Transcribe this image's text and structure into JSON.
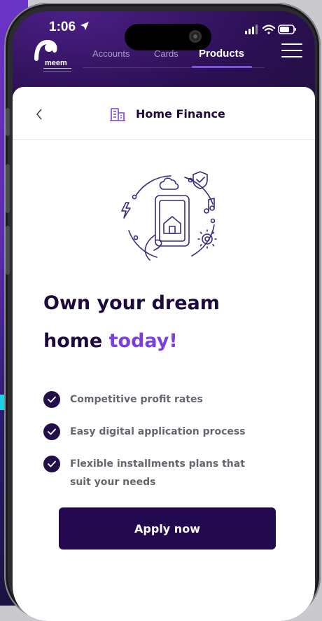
{
  "status": {
    "time": "1:06"
  },
  "brand": {
    "name": "meem"
  },
  "nav": {
    "tabs": [
      {
        "label": "Accounts"
      },
      {
        "label": "Cards"
      },
      {
        "label": "Products"
      }
    ],
    "active": "Products"
  },
  "page": {
    "title": "Home Finance"
  },
  "hero": {
    "headline_line1": "Own your dream",
    "headline_prefix": "home ",
    "headline_accent": "today!"
  },
  "benefits": [
    {
      "text": "Competitive profit rates"
    },
    {
      "text": "Easy digital application process"
    },
    {
      "text": "Flexible installments plans that suit your needs"
    }
  ],
  "cta": {
    "label": "Apply now"
  },
  "colors": {
    "primary": "#230a4f",
    "accent": "#7b3fe0",
    "header_bg": "#2b0f52"
  },
  "icons": [
    "location-arrow-icon",
    "signal-icon",
    "wifi-icon",
    "battery-icon",
    "menu-icon",
    "back-chevron-icon",
    "building-icon",
    "check-icon"
  ]
}
